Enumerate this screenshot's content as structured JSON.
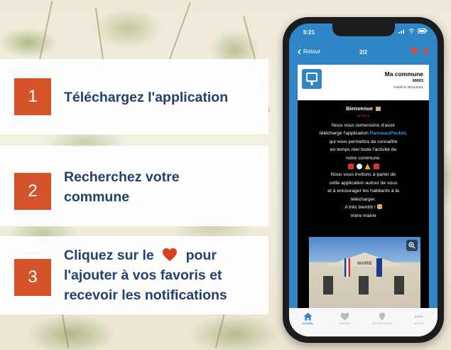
{
  "steps": [
    {
      "number": "1",
      "text_line1": "Téléchargez l'application"
    },
    {
      "number": "2",
      "text_line1": "Recherchez votre",
      "text_line2": "commune"
    },
    {
      "number": "3",
      "text_before_heart": "Cliquez sur le",
      "text_after_heart": "pour",
      "text_line2": "l'ajouter à vos favoris et",
      "text_line3": "recevoir les notifications"
    }
  ],
  "phone": {
    "status_time": "5:21",
    "back_label": "Retour",
    "pager": "2/2",
    "commune": {
      "name": "Ma commune",
      "code": "69003",
      "published": "Publié le 30/11/2021"
    },
    "message": {
      "title": "Bienvenue",
      "line1": "Nous vous remercions d'avoir",
      "line2_before": "téléchargé l'application",
      "app_name": "PanneauPocket",
      "line3": "qui vous permettra de connaître",
      "line4": "en temps réel toute l'activité de",
      "line5": "notre commune.",
      "line6": "Nous vous invitons à parler de",
      "line7": "cette application autour de vous",
      "line8": "et à encourager les habitants à la",
      "line9": "télécharger.",
      "line10": "A très bientôt !",
      "line11": "Votre mairie"
    },
    "building_sign": "MAIRIE",
    "tabs": [
      {
        "label": "ACCUEIL",
        "icon": "home-icon",
        "active": true
      },
      {
        "label": "FAVORIS",
        "icon": "heart-icon",
        "active": false
      },
      {
        "label": "AUTOUR DE MOI",
        "icon": "location-icon",
        "active": false
      },
      {
        "label": "AUTRES",
        "icon": "more-icon",
        "active": false
      }
    ]
  },
  "colors": {
    "accent_orange": "#d4532a",
    "text_navy": "#23406f",
    "heart_red": "#d9411e",
    "app_blue": "#2e86c7"
  }
}
